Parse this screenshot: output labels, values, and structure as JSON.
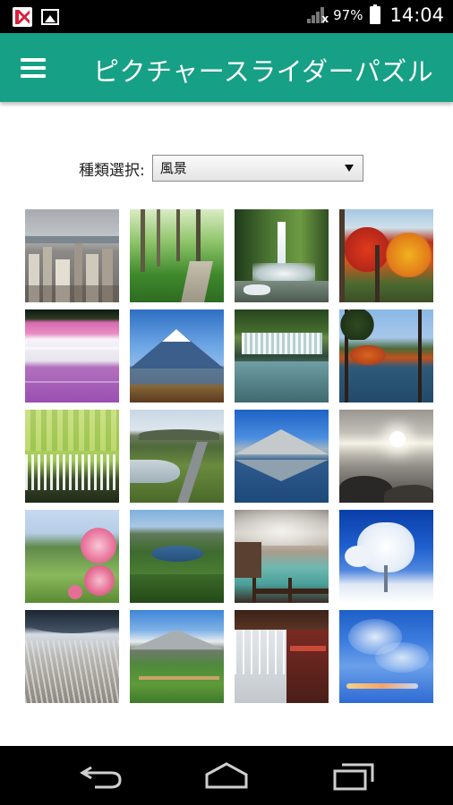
{
  "status_bar": {
    "battery_percent": "97%",
    "time": "14:04",
    "icons": [
      "kaspersky-icon",
      "gallery-notification-icon",
      "signal-icon",
      "battery-icon"
    ]
  },
  "app_bar": {
    "title": "ピクチャースライダーパズル",
    "menu_icon": "hamburger-menu-icon",
    "color": "#16a085"
  },
  "type_selector": {
    "label": "種類選択:",
    "selected": "風景"
  },
  "thumbnails": [
    "city-skyline",
    "forest-boardwalk",
    "forest-waterfall",
    "autumn-maple",
    "moss-phlox-field",
    "mount-fuji",
    "shiraito-falls",
    "autumn-lake",
    "wisteria",
    "marsh-boardwalk",
    "mountain-reflection",
    "sunset-coast",
    "hollyhock-flowers",
    "crater-lake",
    "hot-spring-town",
    "snow-covered-trees",
    "pampas-grass",
    "alpine-meadow",
    "icicles-eaves",
    "blue-sky-clouds"
  ],
  "nav_bar": {
    "icons": [
      "back-icon",
      "home-icon",
      "recent-apps-icon"
    ]
  }
}
